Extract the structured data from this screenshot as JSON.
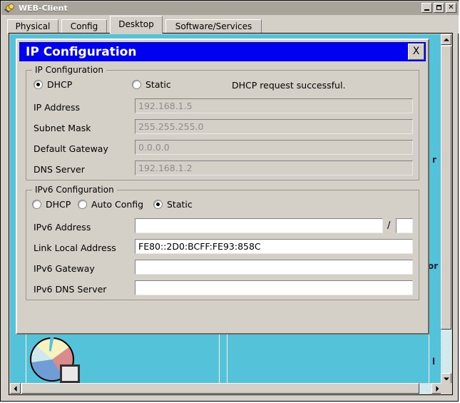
{
  "window": {
    "title": "WEB-Client",
    "icon": "magnifier-coin-icon",
    "controls": {
      "minimize": "_",
      "maximize": "□",
      "close": "✕"
    }
  },
  "tabs": [
    {
      "label": "Physical",
      "active": false
    },
    {
      "label": "Config",
      "active": false
    },
    {
      "label": "Desktop",
      "active": true
    },
    {
      "label": "Software/Services",
      "active": false
    }
  ],
  "desktop": {
    "background_color": "#54c2d8",
    "icon_label_fragments": [
      "r",
      "or",
      "l"
    ],
    "partial_icon": "pie-chart-document-icon"
  },
  "dialog": {
    "title": "IP Configuration",
    "close_label": "X",
    "title_bar_color": "#0000f0",
    "ipv4": {
      "group_title": "IP Configuration",
      "mode_options": [
        {
          "label": "DHCP",
          "selected": true
        },
        {
          "label": "Static",
          "selected": false
        }
      ],
      "status_message": "DHCP request successful.",
      "fields": [
        {
          "label": "IP Address",
          "value": "192.168.1.5",
          "disabled": true
        },
        {
          "label": "Subnet Mask",
          "value": "255.255.255.0",
          "disabled": true
        },
        {
          "label": "Default Gateway",
          "value": "0.0.0.0",
          "disabled": true
        },
        {
          "label": "DNS Server",
          "value": "192.168.1.2",
          "disabled": true
        }
      ]
    },
    "ipv6": {
      "group_title": "IPv6 Configuration",
      "mode_options": [
        {
          "label": "DHCP",
          "selected": false
        },
        {
          "label": "Auto Config",
          "selected": false
        },
        {
          "label": "Static",
          "selected": true
        }
      ],
      "prefix_separator": "/",
      "prefix_value": "",
      "fields": [
        {
          "label": "IPv6 Address",
          "value": "",
          "disabled": false
        },
        {
          "label": "Link Local Address",
          "value": "FE80::2D0:BCFF:FE93:858C",
          "disabled": false
        },
        {
          "label": "IPv6 Gateway",
          "value": "",
          "disabled": false
        },
        {
          "label": "IPv6 DNS Server",
          "value": "",
          "disabled": false
        }
      ]
    }
  }
}
